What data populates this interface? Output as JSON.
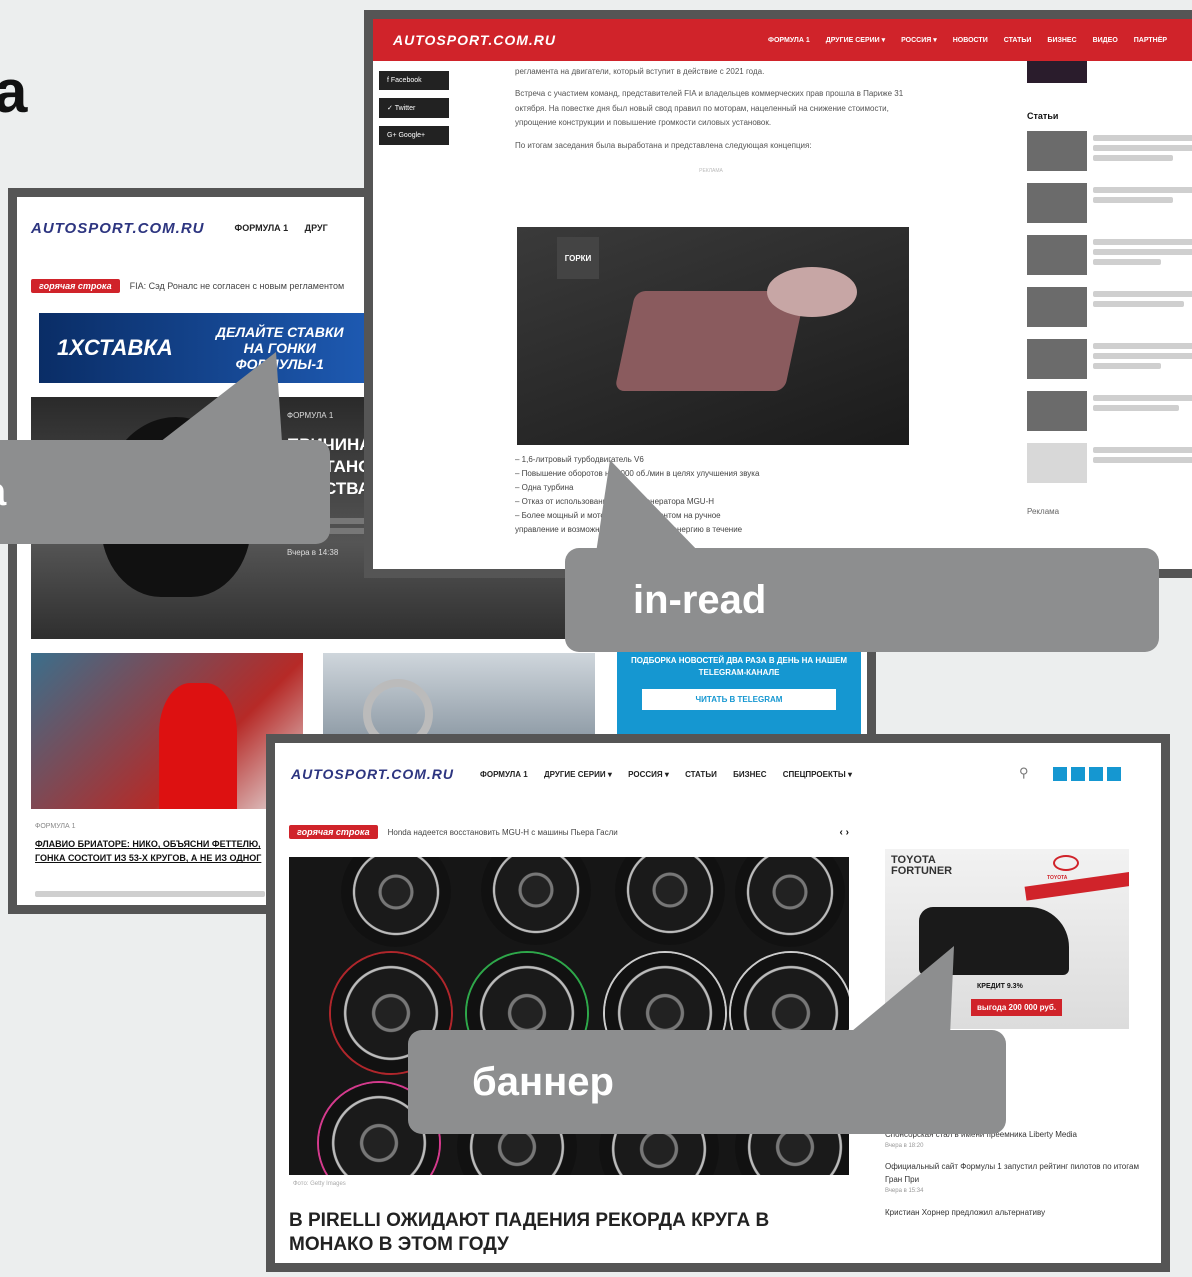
{
  "corner_text": "а",
  "screen1": {
    "logo": "AUTOSPORT.COM.RU",
    "nav": [
      "ФОРМУЛА 1",
      "ДРУГ"
    ],
    "breaking_label": "горячая строка",
    "breaking_text": "FIA: Сэд Роналс не согласен с новым регламентом",
    "ad_brand": "1XСТАВКА",
    "ad_text": "ДЕЛАЙТЕ СТАВКИ НА ГОНКИ ФОРМУЛЫ-1",
    "hero_category": "ФОРМУЛА 1",
    "hero_title": "ПРИЧИНА ПОСТАНОВКИ ВОДСТВА",
    "hero_time": "Вчера в 14:38",
    "telegram_text": "ПОДБОРКА НОВОСТЕЙ ДВА РАЗА В ДЕНЬ НА НАШЕМ TELEGRAM-КАНАЛЕ",
    "telegram_button": "ЧИТАТЬ В TELEGRAM",
    "card_category": "ФОРМУЛА 1",
    "card_title": "ФЛАВИО БРИАТОРЕ: НИКО, ОБЪЯСНИ ФЕТТЕЛЮ, ГОНКА СОСТОИТ ИЗ 53-Х КРУГОВ, А НЕ ИЗ ОДНОГ"
  },
  "screen2": {
    "logo": "AUTOSPORT.COM.RU",
    "nav": [
      "ФОРМУЛА 1",
      "ДРУГИЕ СЕРИИ ▾",
      "РОССИЯ ▾",
      "НОВОСТИ",
      "СТАТЬИ",
      "БИЗНЕС",
      "ВИДЕО",
      "ПАРТНЁР"
    ],
    "share": [
      "Facebook",
      "Twitter",
      "Google+"
    ],
    "para1": "регламента на двигатели, который вступит в действие с 2021 года.",
    "para2": "Встреча с участием команд, представителей FIA и владельцев коммерческих прав прошла в Париже 31 октября. На повестке дня был новый свод правил по моторам, нацеленный на снижение стоимости, упрощение конструкции и повышение громкости силовых установок.",
    "para3": "По итогам заседания была выработана и представлена следующая концепция:",
    "ad_marker": "РЕКЛАМА",
    "ad_label": "ГОРКИ",
    "bullets": [
      "– 1,6-литровый турбодвигатель V6",
      "– Повышение оборотов на 3000 об./мин в целях улучшения звука",
      "– Одна турбина",
      "– Отказ от использования мотора-генератора MGU-H",
      "– Более мощный и мотор MGU-K с акцентом на ручное",
      "управление и возможностью накапливать энергию в течение"
    ],
    "sidebar_heading": "Статьи",
    "sidebar_footer": "Реклама"
  },
  "screen3": {
    "logo": "AUTOSPORT.COM.RU",
    "nav": [
      "ФОРМУЛА 1",
      "ДРУГИЕ СЕРИИ ▾",
      "РОССИЯ ▾",
      "СТАТЬИ",
      "БИЗНЕС",
      "СПЕЦПРОЕКТЫ ▾"
    ],
    "breaking_label": "горячая строка",
    "breaking_text": "Honda надеется восстановить MGU-H с машины Пьера Гасли",
    "nav_arrows": "‹ ›",
    "photo_credit": "Фото: Getty Images",
    "article_title": "В PIRELLI ОЖИДАЮТ ПАДЕНИЯ РЕКОРДА КРУГА В МОНАКО В ЭТОМ ГОДУ",
    "banner_title": "TOYOTA FORTUNER",
    "banner_brand": "TOYOTA",
    "banner_credit": "КРЕДИТ 9.3%",
    "banner_price": "выгода 200 000 руб.",
    "news": [
      {
        "title": "Спонсорская стал в имени преемника Liberty Media",
        "time": "Вчера в 18:20"
      },
      {
        "title": "Официальный сайт Формулы 1 запустил рейтинг пилотов по итогам Гран При",
        "time": "Вчера в 15:34"
      },
      {
        "title": "Кристиан Хорнер предложил альтернативу",
        "time": ""
      }
    ]
  },
  "callouts": {
    "left": "а",
    "inread": "in-read",
    "banner": "баннер"
  },
  "colors": {
    "red": "#d0232a",
    "blue": "#1597d1",
    "gray": "#8d8e8f",
    "frame": "#555555"
  }
}
